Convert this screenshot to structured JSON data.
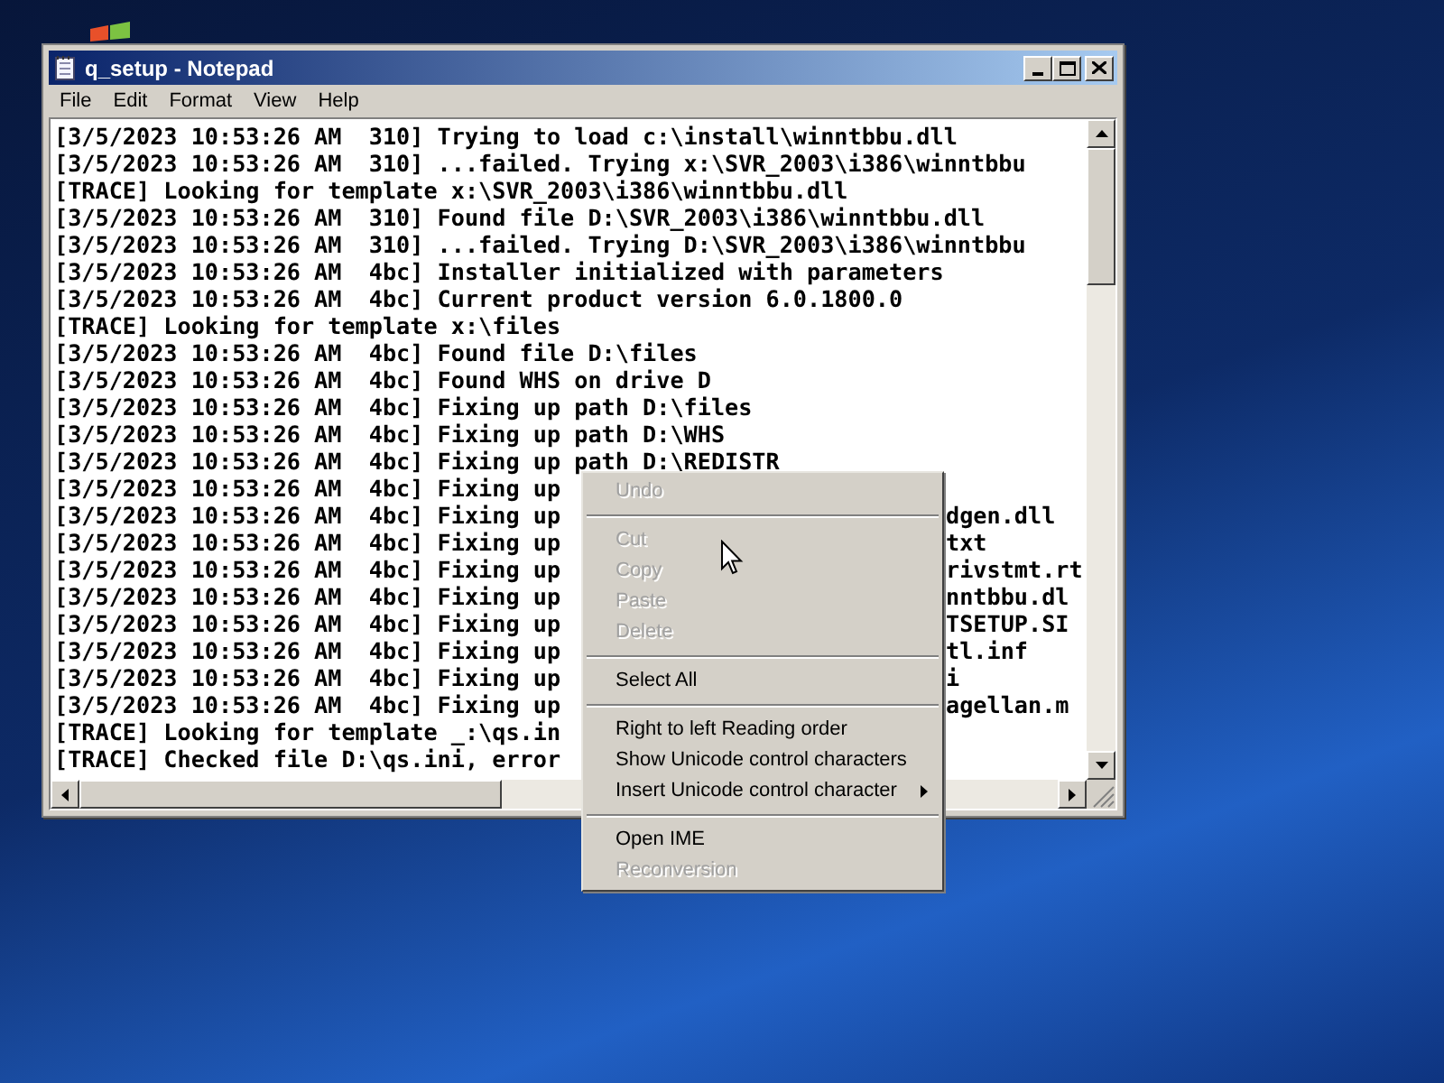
{
  "window": {
    "title": "q_setup - Notepad"
  },
  "menu_bar": [
    "File",
    "Edit",
    "Format",
    "View",
    "Help"
  ],
  "lines": [
    {
      "text": "[3/5/2023 10:53:26 AM  310] Trying to load c:\\install\\winntbbu.dll"
    },
    {
      "text": "[3/5/2023 10:53:26 AM  310] ...failed. Trying x:\\SVR_2003\\i386\\winntbbu"
    },
    {
      "text": "[TRACE] Looking for template x:\\SVR_2003\\i386\\winntbbu.dll"
    },
    {
      "text": "[3/5/2023 10:53:26 AM  310] Found file D:\\SVR_2003\\i386\\winntbbu.dll"
    },
    {
      "text": "[3/5/2023 10:53:26 AM  310] ...failed. Trying D:\\SVR_2003\\i386\\winntbbu"
    },
    {
      "text": "[3/5/2023 10:53:26 AM  4bc] Installer initialized with parameters"
    },
    {
      "text": "[3/5/2023 10:53:26 AM  4bc] Current product version 6.0.1800.0"
    },
    {
      "text": "[TRACE] Looking for template x:\\files"
    },
    {
      "text": "[3/5/2023 10:53:26 AM  4bc] Found file D:\\files"
    },
    {
      "text": "[3/5/2023 10:53:26 AM  4bc] Found WHS on drive D"
    },
    {
      "text": "[3/5/2023 10:53:26 AM  4bc] Fixing up path D:\\files"
    },
    {
      "text": "[3/5/2023 10:53:26 AM  4bc] Fixing up path D:\\WHS"
    },
    {
      "text": "[3/5/2023 10:53:26 AM  4bc] Fixing up path D:\\REDISTR"
    },
    {
      "text": "[3/5/2023 10:53:26 AM  4bc] Fixing up"
    },
    {
      "text": "[3/5/2023 10:53:26 AM  4bc] Fixing up",
      "tail": "dgen.dll"
    },
    {
      "text": "[3/5/2023 10:53:26 AM  4bc] Fixing up",
      "tail": "txt"
    },
    {
      "text": "[3/5/2023 10:53:26 AM  4bc] Fixing up",
      "tail": "rivstmt.rt"
    },
    {
      "text": "[3/5/2023 10:53:26 AM  4bc] Fixing up",
      "tail": "nntbbu.dl"
    },
    {
      "text": "[3/5/2023 10:53:26 AM  4bc] Fixing up",
      "tail": "TSETUP.SI"
    },
    {
      "text": "[3/5/2023 10:53:26 AM  4bc] Fixing up",
      "tail": "tl.inf"
    },
    {
      "text": "[3/5/2023 10:53:26 AM  4bc] Fixing up",
      "tail": "i"
    },
    {
      "text": "[3/5/2023 10:53:26 AM  4bc] Fixing up",
      "tail": "agellan.m"
    },
    {
      "text": "[TRACE] Looking for template _:\\qs.in"
    },
    {
      "text": "[TRACE] Checked file D:\\qs.ini, error"
    }
  ],
  "context_menu": [
    {
      "kind": "item",
      "label": "Undo",
      "disabled": true
    },
    {
      "kind": "separator"
    },
    {
      "kind": "item",
      "label": "Cut",
      "disabled": true
    },
    {
      "kind": "item",
      "label": "Copy",
      "disabled": true
    },
    {
      "kind": "item",
      "label": "Paste",
      "disabled": true
    },
    {
      "kind": "item",
      "label": "Delete",
      "disabled": true
    },
    {
      "kind": "separator"
    },
    {
      "kind": "item",
      "label": "Select All",
      "disabled": false
    },
    {
      "kind": "separator"
    },
    {
      "kind": "item",
      "label": "Right to left Reading order",
      "disabled": false
    },
    {
      "kind": "item",
      "label": "Show Unicode control characters",
      "disabled": false
    },
    {
      "kind": "submenu",
      "label": "Insert Unicode control character",
      "disabled": false
    },
    {
      "kind": "separator"
    },
    {
      "kind": "item",
      "label": "Open IME",
      "disabled": false
    },
    {
      "kind": "item",
      "label": "Reconversion",
      "disabled": true
    }
  ]
}
